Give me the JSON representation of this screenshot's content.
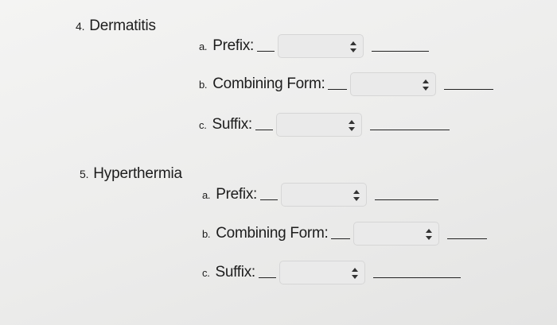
{
  "questions": [
    {
      "number": "4.",
      "term": "Dermatitis",
      "parts": [
        {
          "letter": "a.",
          "label": "Prefix:"
        },
        {
          "letter": "b.",
          "label": "Combining Form:"
        },
        {
          "letter": "c.",
          "label": "Suffix:"
        }
      ]
    },
    {
      "number": "5.",
      "term": "Hyperthermia",
      "parts": [
        {
          "letter": "a.",
          "label": "Prefix:"
        },
        {
          "letter": "b.",
          "label": "Combining Form:"
        },
        {
          "letter": "c.",
          "label": "Suffix:"
        }
      ]
    }
  ],
  "dropdown_icon": "up-down-arrows-icon"
}
